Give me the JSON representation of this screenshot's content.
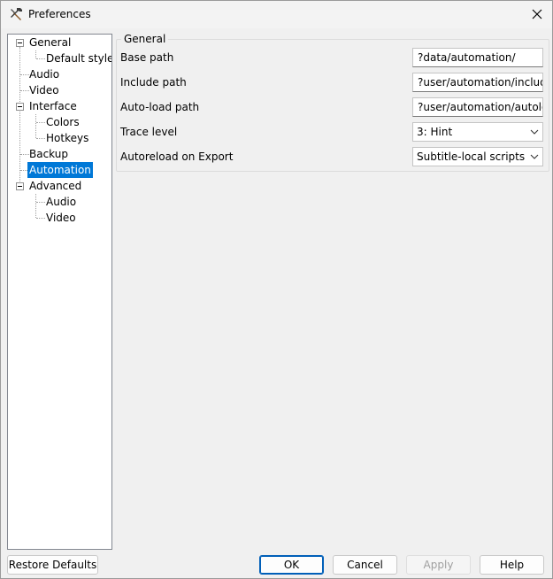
{
  "window": {
    "title": "Preferences"
  },
  "tree": {
    "items": [
      {
        "label": "General"
      },
      {
        "label": "Default styles"
      },
      {
        "label": "Audio"
      },
      {
        "label": "Video"
      },
      {
        "label": "Interface"
      },
      {
        "label": "Colors"
      },
      {
        "label": "Hotkeys"
      },
      {
        "label": "Backup"
      },
      {
        "label": "Automation",
        "selected": true
      },
      {
        "label": "Advanced"
      },
      {
        "label": "Audio"
      },
      {
        "label": "Video"
      }
    ]
  },
  "panel": {
    "group_title": "General",
    "base_path": {
      "label": "Base path",
      "value": "?data/automation/"
    },
    "include_path": {
      "label": "Include path",
      "value": "?user/automation/include/"
    },
    "autoload_path": {
      "label": "Auto-load path",
      "value": "?user/automation/autoload/"
    },
    "trace_level": {
      "label": "Trace level",
      "value": "3: Hint"
    },
    "autoreload": {
      "label": "Autoreload on Export",
      "value": "Subtitle-local scripts"
    }
  },
  "buttons": {
    "restore_defaults": "Restore Defaults",
    "ok": "OK",
    "cancel": "Cancel",
    "apply": "Apply",
    "help": "Help"
  },
  "colors": {
    "selection": "#0078d7",
    "default_button_border": "#005fb8"
  },
  "icons": {
    "app": "hammer-wrench-icon",
    "close": "close-icon",
    "expander": "tree-collapse-icon",
    "dropdown": "chevron-down-icon"
  }
}
